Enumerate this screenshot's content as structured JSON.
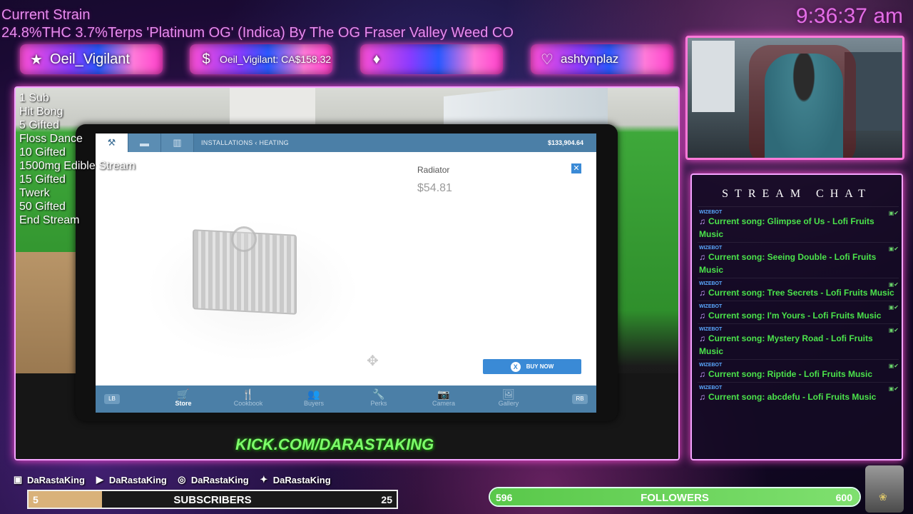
{
  "overlay": {
    "strain_title": "Current Strain",
    "strain_line": "24.8%THC 3.7%Terps 'Platinum OG' (Indica) By The OG Fraser Valley Weed CO",
    "clock": "9:36:37 am",
    "banners": [
      {
        "icon": "star-icon",
        "text": "Oeil_Vigilant"
      },
      {
        "icon": "dollar-coin-icon",
        "text": "Oeil_Vigilant: CA$158.32"
      },
      {
        "icon": "diamond-icon",
        "text": ""
      },
      {
        "icon": "heart-icon",
        "text": "ashtynplaz"
      }
    ],
    "commands": [
      "1 Sub",
      "Hit Bong",
      "5 Gifted",
      "Floss Dance",
      "10 Gifted",
      "1500mg Edible Stream",
      "15 Gifted",
      "Twerk",
      "50 Gifted",
      "End Stream"
    ],
    "kick_url": "KICK.COM/DARASTAKING"
  },
  "tablet": {
    "breadcrumb_1": "INSTALLATIONS",
    "breadcrumb_sep": "‹",
    "breadcrumb_2": "HEATING",
    "balance": "$133,904.64",
    "item_name": "Radiator",
    "item_price": "$54.81",
    "close_label": "✕",
    "buy_button_key": "X",
    "buy_button_label": "BUY NOW",
    "lb_label": "LB",
    "rb_label": "RB",
    "nav": [
      {
        "label": "Store",
        "icon": "cart-icon",
        "active": true
      },
      {
        "label": "Cookbook",
        "icon": "utensils-icon",
        "active": false
      },
      {
        "label": "Buyers",
        "icon": "people-icon",
        "active": false
      },
      {
        "label": "Perks",
        "icon": "wrench-icon",
        "active": false
      },
      {
        "label": "Camera",
        "icon": "camera-icon",
        "active": false
      },
      {
        "label": "Gallery",
        "icon": "image-icon",
        "active": false
      }
    ]
  },
  "chat": {
    "title": "STREAM CHAT",
    "messages": [
      {
        "author": "WIZEBOT",
        "text": "Current song: Glimpse of Us - Lofi Fruits Music"
      },
      {
        "author": "WIZEBOT",
        "text": "Current song: Seeing Double - Lofi Fruits Music"
      },
      {
        "author": "WIZEBOT",
        "text": "Current song: Tree Secrets - Lofi Fruits Music"
      },
      {
        "author": "WIZEBOT",
        "text": "Current song: I'm Yours - Lofi Fruits Music"
      },
      {
        "author": "WIZEBOT",
        "text": "Current song: Mystery Road - Lofi Fruits Music"
      },
      {
        "author": "WIZEBOT",
        "text": "Current song: Riptide - Lofi Fruits Music"
      },
      {
        "author": "WIZEBOT",
        "text": "Current song: abcdefu - Lofi Fruits Music"
      }
    ]
  },
  "socials": [
    {
      "icon": "twitch-icon",
      "handle": "DaRastaKing"
    },
    {
      "icon": "youtube-icon",
      "handle": "DaRastaKing"
    },
    {
      "icon": "instagram-icon",
      "handle": "DaRastaKing"
    },
    {
      "icon": "twitter-icon",
      "handle": "DaRastaKing"
    }
  ],
  "goals": {
    "subscribers": {
      "label": "SUBSCRIBERS",
      "min": "5",
      "max": "25",
      "progress": 0.2
    },
    "followers": {
      "label": "FOLLOWERS",
      "min": "596",
      "max": "600",
      "progress": 1.0
    }
  },
  "colors": {
    "accent_pink": "#ff4fd6",
    "game_blue": "#4b7fa7",
    "buy_blue": "#3a8ad6",
    "chat_green": "#4be34b",
    "kick_green": "#7dff6a"
  }
}
